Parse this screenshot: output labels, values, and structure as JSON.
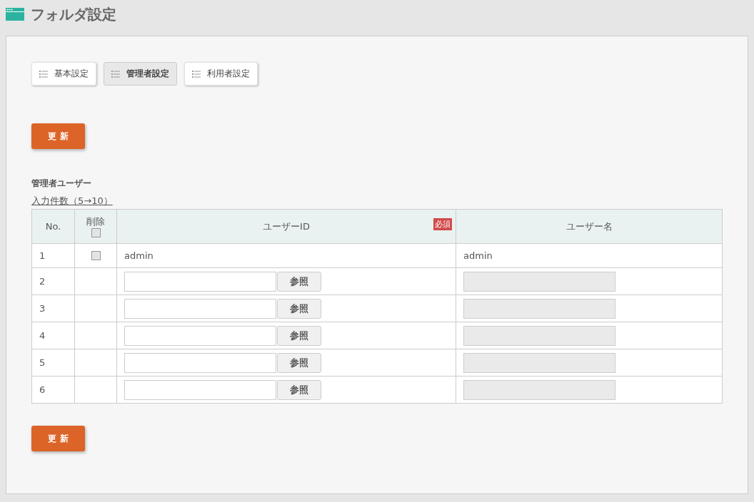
{
  "page_title": "フォルダ設定",
  "tabs": [
    {
      "label": "基本設定",
      "selected": false
    },
    {
      "label": "管理者設定",
      "selected": true
    },
    {
      "label": "利用者設定",
      "selected": false
    }
  ],
  "update_buttons": [
    "更 新",
    "更 新"
  ],
  "section_title": "管理者ユーザー",
  "count_link": "入力件数（5→10）",
  "table": {
    "columns": [
      {
        "kind": "plain",
        "label": "No."
      },
      {
        "kind": "checkbox",
        "label": "削除",
        "checked": false
      },
      {
        "kind": "badge",
        "label": "ユーザーID",
        "badge": "必須"
      },
      {
        "kind": "plain",
        "label": "ユーザー名"
      }
    ],
    "rows": [
      {
        "kind": "text",
        "no": "1",
        "checked": false,
        "user_id": "admin",
        "user_name": "admin"
      },
      {
        "kind": "input",
        "no": "2",
        "browse": "参照"
      },
      {
        "kind": "input",
        "no": "3",
        "browse": "参照"
      },
      {
        "kind": "input",
        "no": "4",
        "browse": "参照"
      },
      {
        "kind": "input",
        "no": "5",
        "browse": "参照"
      },
      {
        "kind": "input",
        "no": "6",
        "browse": "参照"
      }
    ]
  }
}
